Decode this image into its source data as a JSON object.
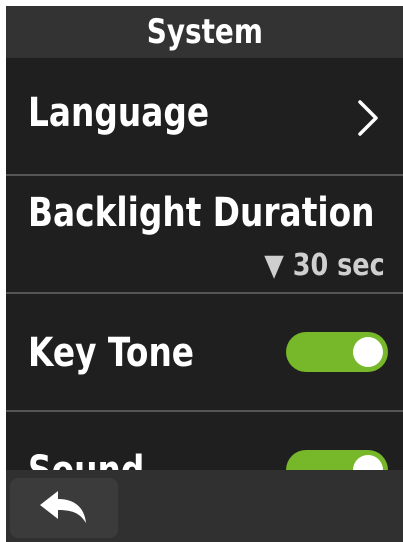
{
  "header": {
    "title": "System"
  },
  "settings": {
    "language": {
      "label": "Language",
      "icon": "chevron-right-icon"
    },
    "backlight": {
      "label": "Backlight Duration",
      "value": "▼ 30 sec"
    },
    "key_tone": {
      "label": "Key Tone",
      "enabled": true
    },
    "sound": {
      "label": "Sound",
      "enabled": true
    }
  },
  "footer": {
    "back_icon": "back-arrow-icon"
  },
  "colors": {
    "toggle_on": "#76b82a",
    "background": "#1c1c1c",
    "header": "#333333"
  }
}
